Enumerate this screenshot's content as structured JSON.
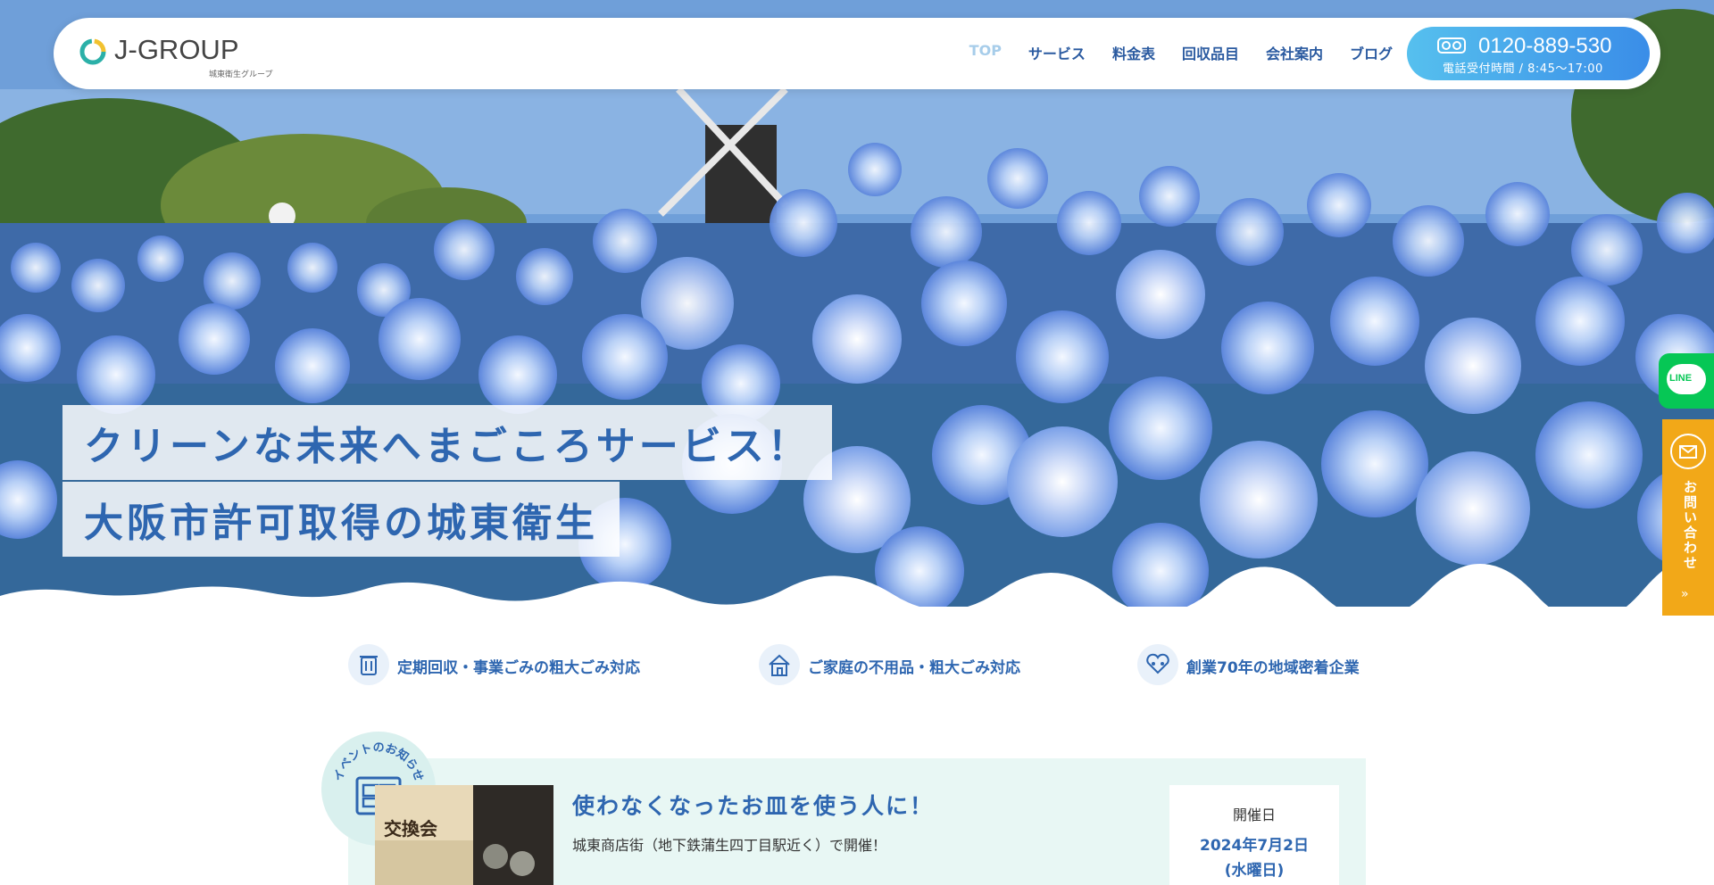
{
  "header": {
    "logo_text": "J-GROUP",
    "logo_sub": "城東衛生グループ",
    "nav": [
      {
        "label": "TOP",
        "active": true
      },
      {
        "label": "サービス"
      },
      {
        "label": "料金表"
      },
      {
        "label": "回収品目"
      },
      {
        "label": "会社案内"
      },
      {
        "label": "ブログ"
      }
    ],
    "phone": {
      "number": "0120-889-530",
      "hours": "電話受付時間 / 8:45〜17:00",
      "icon": "free-dial-icon"
    }
  },
  "hero": {
    "catch_line1": "クリーンな未来へまごころサービス！",
    "catch_line2": "大阪市許可取得の城東衛生"
  },
  "side": {
    "line_label": "LINE",
    "contact_label": "お問い合わせ",
    "contact_arrow": "»"
  },
  "features": [
    {
      "icon": "trash-can-icon",
      "label": "定期回収・事業ごみの粗大ごみ対応"
    },
    {
      "icon": "house-icon",
      "label": "ご家庭の不用品・粗大ごみ対応"
    },
    {
      "icon": "community-heart-icon",
      "label": "創業70年の地域密着企業"
    }
  ],
  "event": {
    "badge": "イベントのお知らせ",
    "title": "使わなくなったお皿を使う人に！",
    "description": "城東商店街（地下鉄蒲生四丁目駅近く）で開催！",
    "date_label": "開催日",
    "date": "2024年7月2日",
    "weekday": "(水曜日)",
    "photo_text": "交換会"
  },
  "colors": {
    "brand_blue": "#2e66b0",
    "nav_active": "#a7cdea",
    "phone_gradient_start": "#56c0ee",
    "phone_gradient_end": "#3a8de8",
    "line_green": "#06c755",
    "contact_orange": "#f2a818",
    "event_bg": "#e8f7f4"
  }
}
